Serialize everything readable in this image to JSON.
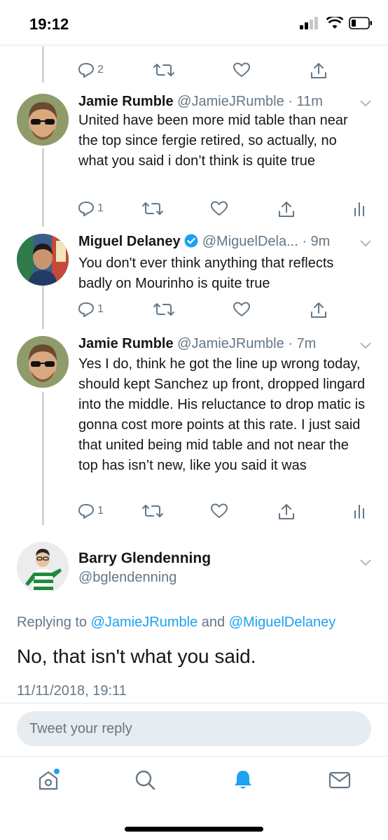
{
  "status_bar": {
    "time": "19:12"
  },
  "tweets": [
    {
      "name": "",
      "handle": "",
      "time": "",
      "text": "",
      "replies": "2"
    },
    {
      "name": "Jamie Rumble",
      "handle": "@JamieJRumble",
      "time": "· 11m",
      "text": "United have been more mid table than near the top since fergie retired, so actually, no what you said i don’t think is quite true",
      "replies": "1"
    },
    {
      "name": "Miguel Delaney",
      "handle": "@MiguelDela... ",
      "time": "· 9m",
      "text": "You don't ever think anything that reflects badly on Mourinho is quite true",
      "replies": "1"
    },
    {
      "name": "Jamie Rumble",
      "handle": "@JamieJRumble",
      "time": "· 7m",
      "text": "Yes I do, think he got the line up wrong today, should kept Sanchez up front, dropped lingard into the middle. His reluctance to drop matic is gonna cost more points at this rate. I just said that united being mid table and not near the top has isn’t new, like you said it was",
      "replies": "1"
    }
  ],
  "main_tweet": {
    "name": "Barry Glendenning",
    "handle": "@bglendenning",
    "replying_prefix": "Replying to",
    "replying_user1": "@JamieJRumble",
    "replying_and": "and",
    "replying_user2": "@MiguelDelaney",
    "text": "No, that isn't what you said.",
    "date": "11/11/2018, 19:11"
  },
  "reply_box": {
    "placeholder": "Tweet your reply"
  },
  "tabbar": {
    "items": [
      "home-icon",
      "search-icon",
      "notifications-icon",
      "messages-icon"
    ],
    "active": "notifications-icon"
  },
  "colors": {
    "accent": "#1da1f2",
    "muted": "#657786",
    "verified": "#1da1f2"
  }
}
